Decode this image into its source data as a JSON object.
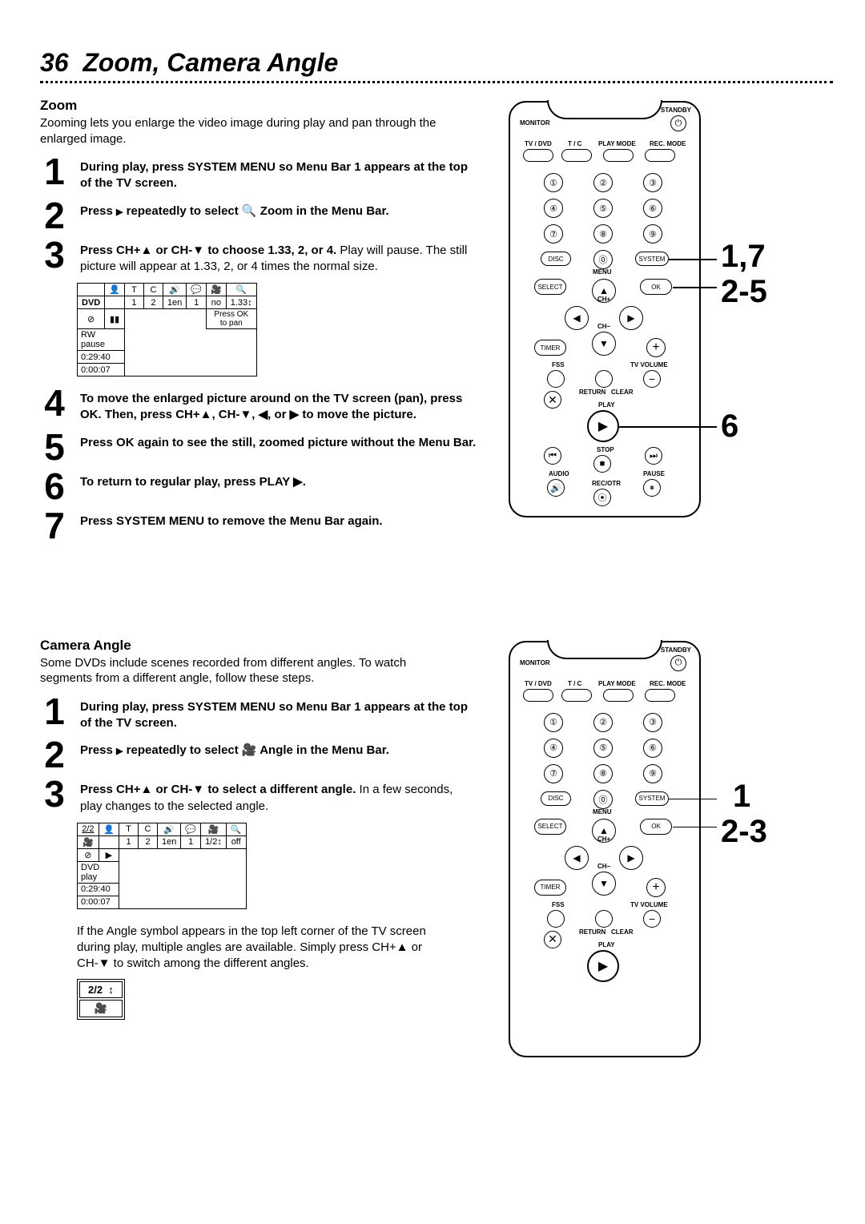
{
  "page_number": "36",
  "page_title_text": "Zoom, Camera Angle",
  "zoom": {
    "heading": "Zoom",
    "intro": "Zooming lets you enlarge the video image during play and pan through the enlarged image.",
    "steps": {
      "1": "During play, press SYSTEM MENU so Menu Bar 1 appears at the top of the TV screen.",
      "2_a": "Press ",
      "2_b": " repeatedly to select ",
      "2_c": " Zoom in the Menu Bar.",
      "3_bold": "Press CH+▲ or CH-▼ to choose 1.33, 2, or 4.",
      "3_plain": " Play will pause. The still picture will appear at 1.33, 2, or 4 times the normal size.",
      "4_a": "To move the enlarged picture around on the TV screen (pan), press OK.  Then, press CH+▲, CH-▼, ◀, or ▶ to move the picture.",
      "5": "Press OK again to see the still, zoomed picture without the Menu Bar.",
      "6": "To return to regular play, press PLAY ▶.",
      "7": "Press SYSTEM MENU to remove the Menu Bar again."
    },
    "osd": {
      "row1": [
        "",
        "",
        "T",
        "C",
        "",
        "",
        "",
        ""
      ],
      "dvd_label": "DVD",
      "row2_values": [
        "1",
        "2",
        "1en",
        "1",
        "no",
        "1.33↕"
      ],
      "status_icon": "⊘",
      "status_play": "▮▮",
      "status_label_top": "RW   pause",
      "press_ok": "Press OK to pan",
      "time1": "0:29:40",
      "time2": "0:00:07"
    },
    "callouts": {
      "c1": "1,7",
      "c2": "2-5",
      "c3": "6"
    }
  },
  "angle": {
    "heading": "Camera Angle",
    "intro": "Some DVDs include scenes recorded from different angles. To watch segments from a different angle, follow these steps.",
    "steps": {
      "1": "During play, press SYSTEM MENU so Menu Bar 1 appears at the top of the TV screen.",
      "2_a": "Press ",
      "2_b": " repeatedly to select ",
      "2_c": "  Angle in the Menu Bar.",
      "3_bold": "Press CH+▲ or CH-▼ to select a different angle.",
      "3_plain": " In a few seconds, play changes to the selected angle."
    },
    "osd": {
      "row1_first": "2/2",
      "row2_first": "🎥",
      "row2_values": [
        "1",
        "2",
        "1en",
        "1",
        "1/2↕",
        "off"
      ],
      "status_label_top": "DVD   play",
      "status_play": "▶",
      "time1": "0:29:40",
      "time2": "0:00:07"
    },
    "note": "If the Angle symbol appears in the top left corner of the TV screen during play, multiple angles are available. Simply press CH+▲ or CH-▼ to switch among the different angles.",
    "badge": {
      "text": "2/2",
      "icon": "🎥",
      "updown": "↕"
    },
    "callouts": {
      "c1": "1",
      "c2": "2-3"
    }
  },
  "remote": {
    "standby": "STANDBY",
    "monitor": "MONITOR",
    "tvdvd": "TV / DVD",
    "tc": "T / C",
    "playmode": "PLAY MODE",
    "recmode": "REC. MODE",
    "nums": [
      "1",
      "2",
      "3",
      "4",
      "5",
      "6",
      "7",
      "8",
      "9",
      "0"
    ],
    "disc": "DISC",
    "system": "SYSTEM",
    "menu": "MENU",
    "select": "SELECT",
    "ok": "OK",
    "chplus": "CH+",
    "chminus": "CH−",
    "timer": "TIMER",
    "fss": "FSS",
    "tvvol": "TV VOLUME",
    "return": "RETURN",
    "clear": "CLEAR",
    "play": "PLAY",
    "stop": "STOP",
    "audio": "AUDIO",
    "pause": "PAUSE",
    "recotr": "REC/OTR",
    "plus": "+",
    "minus": "−"
  }
}
